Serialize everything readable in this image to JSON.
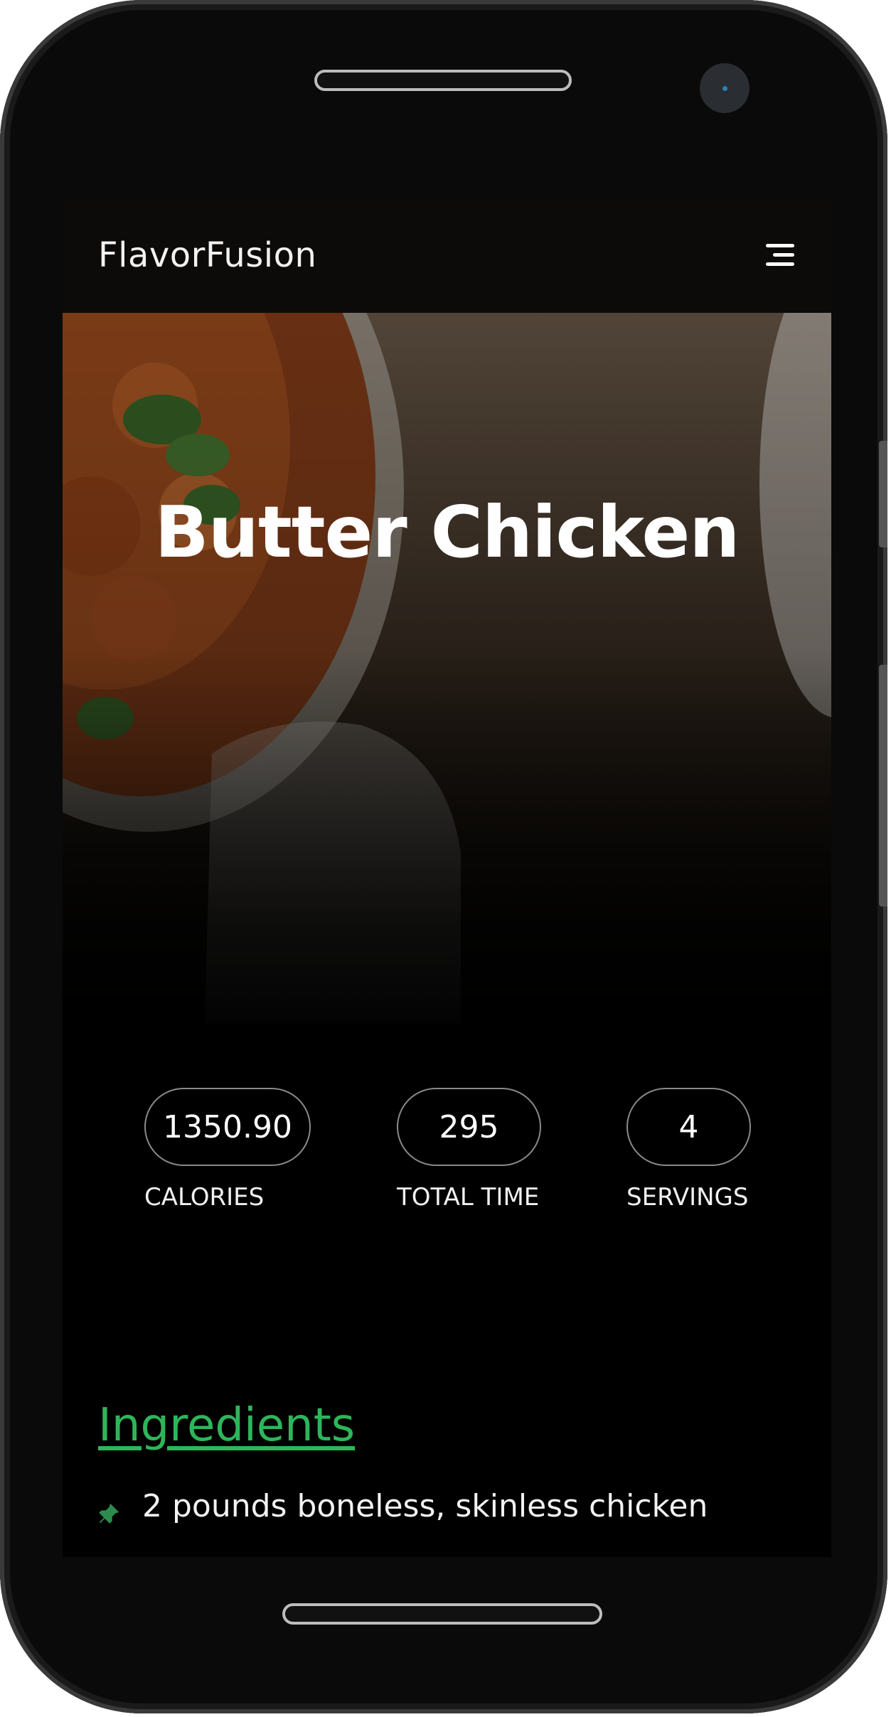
{
  "app": {
    "brand": "FlavorFusion"
  },
  "recipe": {
    "title": "Butter Chicken"
  },
  "stats": [
    {
      "value": "1350.90",
      "label": "CALORIES"
    },
    {
      "value": "295",
      "label": "TOTAL TIME"
    },
    {
      "value": "4",
      "label": "SERVINGS"
    }
  ],
  "ingredients_section": {
    "title": "Ingredients",
    "items": [
      "2 pounds boneless, skinless chicken"
    ]
  },
  "icons": {
    "menu": "hamburger-menu-icon",
    "bullet": "pin-icon"
  },
  "colors": {
    "accent": "#2eb55a",
    "background": "#000000",
    "text": "#ffffff"
  }
}
